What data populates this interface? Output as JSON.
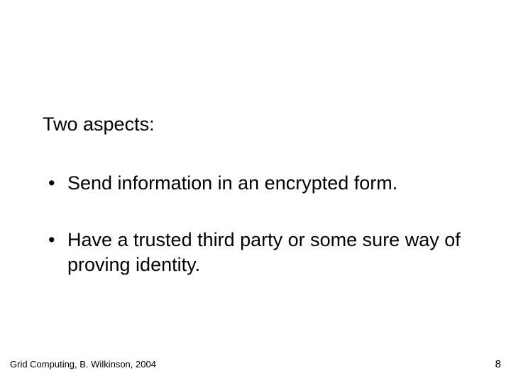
{
  "heading": "Two aspects:",
  "bullets": [
    "Send information in an encrypted form.",
    "Have a trusted third party or some sure way of proving identity."
  ],
  "footer": {
    "left": "Grid Computing, B. Wilkinson, 2004",
    "right": "8"
  }
}
